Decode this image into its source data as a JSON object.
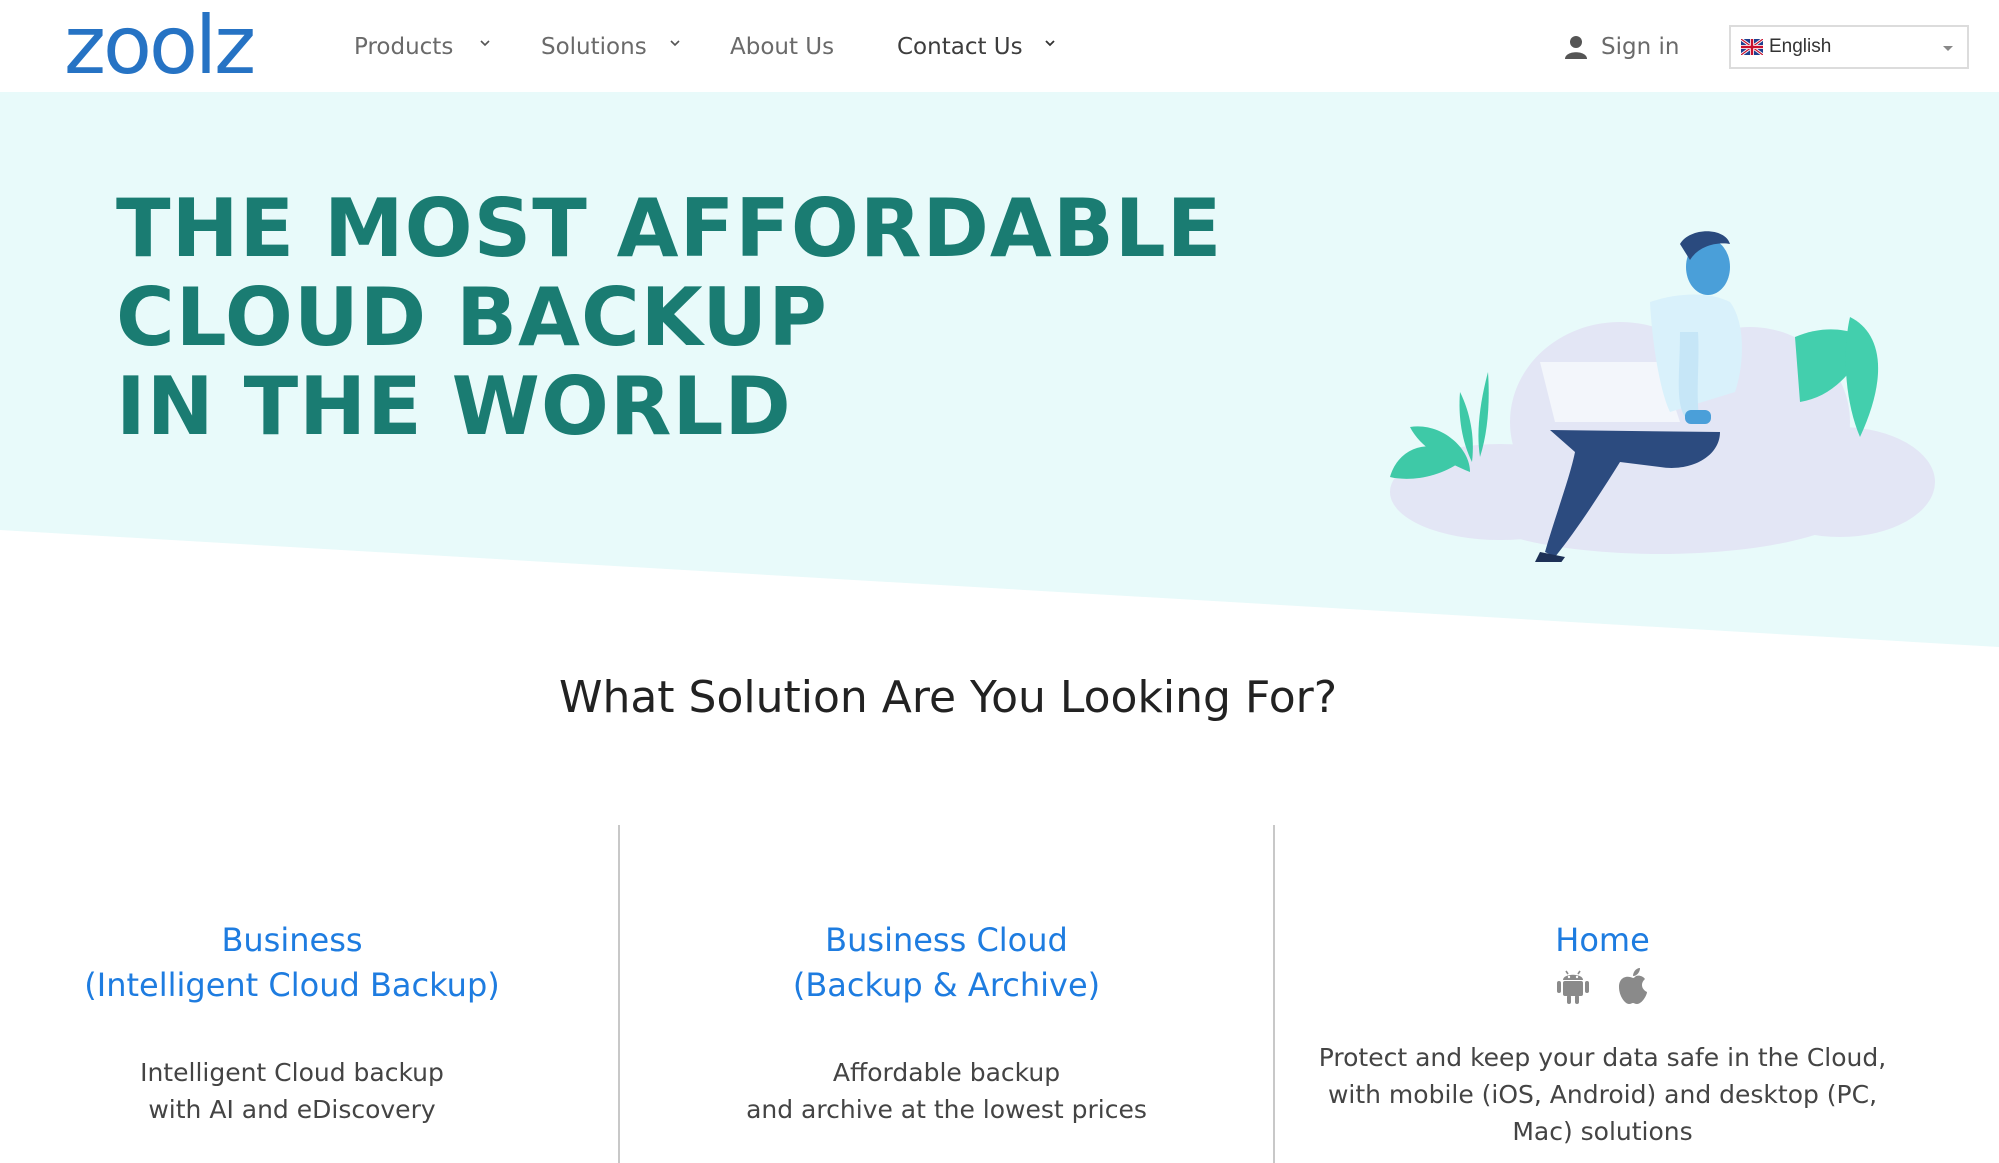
{
  "header": {
    "logo": "zoolz",
    "nav": [
      {
        "label": "Products",
        "dropdown": true
      },
      {
        "label": "Solutions",
        "dropdown": true
      },
      {
        "label": "About Us",
        "dropdown": false
      },
      {
        "label": "Contact Us",
        "dropdown": true
      }
    ],
    "signin_label": "Sign in",
    "language": {
      "selected": "English",
      "flag": "uk-flag-icon"
    }
  },
  "hero": {
    "title_lines": [
      "THE MOST AFFORDABLE",
      "CLOUD BACKUP",
      "IN THE WORLD"
    ],
    "background_color": "#e8fafa",
    "title_color": "#1a7c72"
  },
  "section": {
    "title": "What Solution Are You Looking For?"
  },
  "solutions": [
    {
      "title_lines": [
        "Business",
        "(Intelligent Cloud Backup)"
      ],
      "desc_lines": [
        "Intelligent Cloud backup",
        "with AI and eDiscovery"
      ]
    },
    {
      "title_lines": [
        "Business Cloud",
        "(Backup & Archive)"
      ],
      "desc_lines": [
        "Affordable backup",
        "and archive at the lowest prices"
      ]
    },
    {
      "title_lines": [
        "Home"
      ],
      "icons": [
        "android-icon",
        "apple-icon"
      ],
      "desc_lines": [
        "Protect and keep your data safe in the Cloud,",
        "with mobile (iOS, Android) and desktop (PC,",
        "Mac) solutions"
      ]
    }
  ],
  "colors": {
    "accent_blue": "#1e7ce0",
    "logo_blue": "#2673c4",
    "teal": "#1a7c72"
  }
}
